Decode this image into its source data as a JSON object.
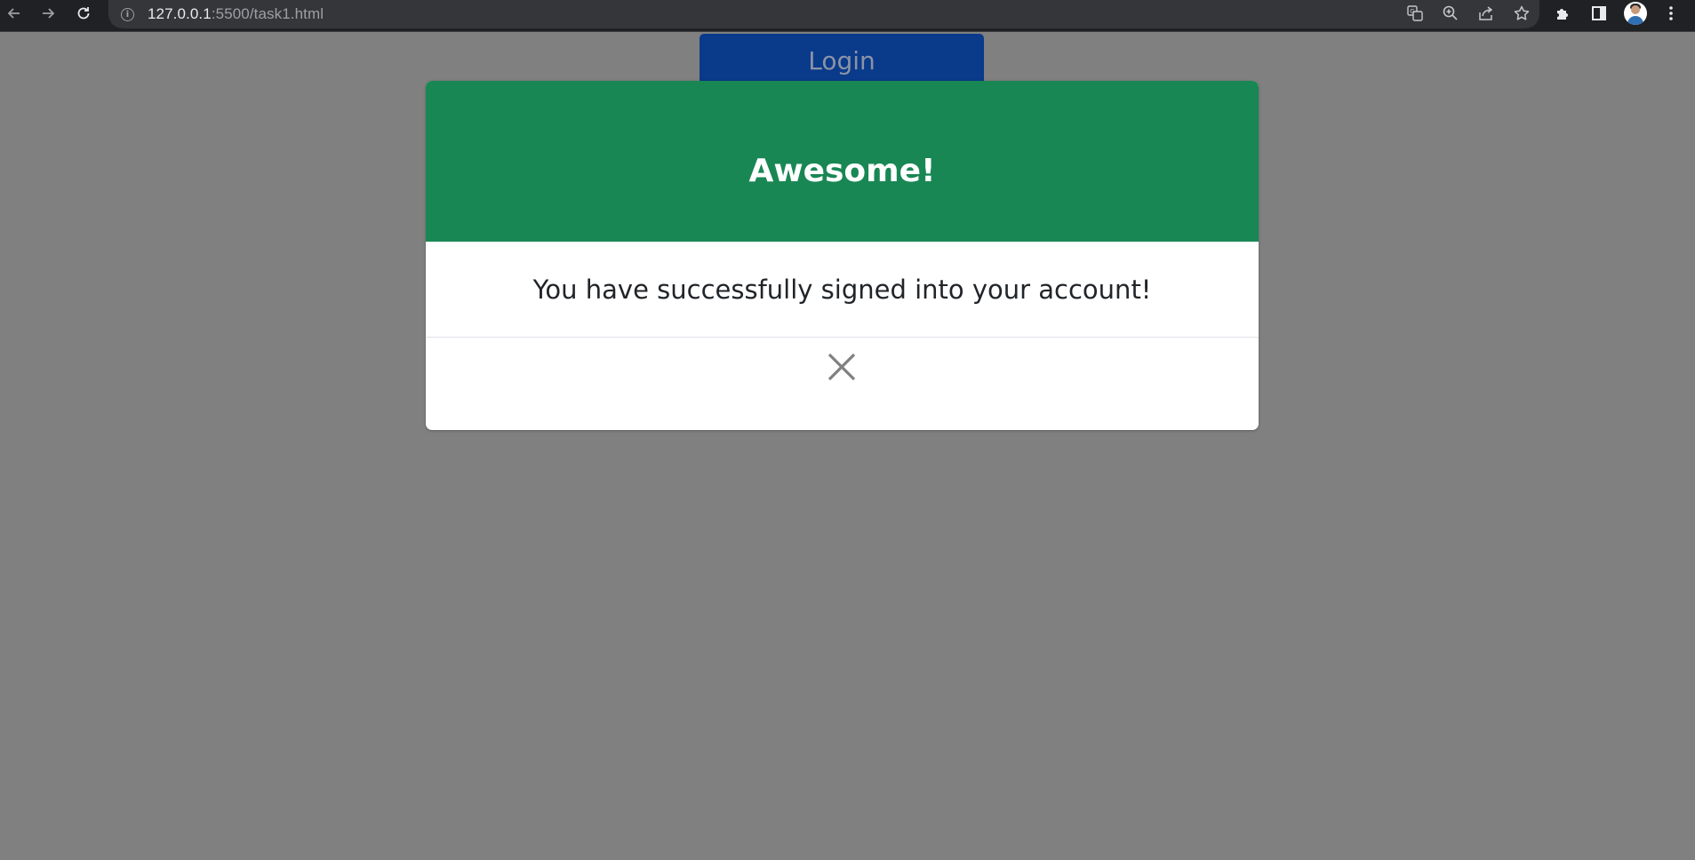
{
  "browser": {
    "url_host": "127.0.0.1",
    "url_rest": ":5500/task1.html",
    "icons": {
      "back": "back-arrow-icon",
      "forward": "forward-arrow-icon",
      "reload": "reload-icon",
      "site_info": "info-icon",
      "translate": "translate-icon",
      "zoom": "zoom-icon",
      "share": "share-icon",
      "bookmark": "star-icon",
      "extensions": "puzzle-icon",
      "side_panel": "side-panel-icon",
      "menu": "kebab-menu-icon"
    }
  },
  "page": {
    "login_label": "Login",
    "overlay_color": "#808080"
  },
  "modal": {
    "title": "Awesome!",
    "message": "You have successfully signed into your account!",
    "close_icon": "close-icon",
    "header_color": "#198754"
  }
}
